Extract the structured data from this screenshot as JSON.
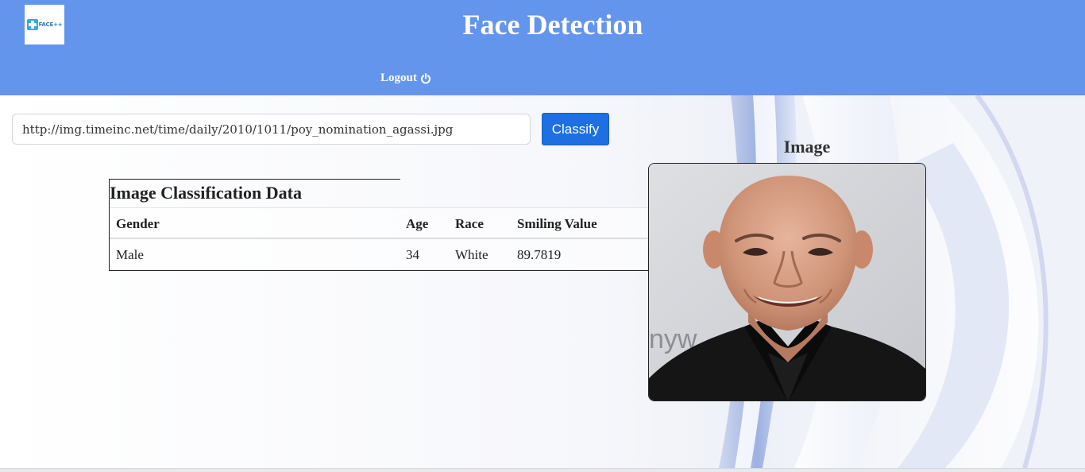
{
  "header": {
    "logo_text": "FACE++",
    "title": "Face Detection",
    "logout_label": "Logout"
  },
  "classify_form": {
    "url_value": "http://img.timeinc.net/time/daily/2010/1011/poy_nomination_agassi.jpg",
    "button_label": "Classify"
  },
  "results": {
    "caption": "Image Classification Data",
    "columns": [
      "Gender",
      "Age",
      "Race",
      "Smiling Value"
    ],
    "rows": [
      [
        "Male",
        "34",
        "White",
        "89.7819"
      ]
    ]
  },
  "image_panel": {
    "heading": "Image",
    "photo_icon": "face-photo"
  },
  "colors": {
    "header_bg": "#6495ed",
    "button_bg": "#1e6fe0"
  }
}
